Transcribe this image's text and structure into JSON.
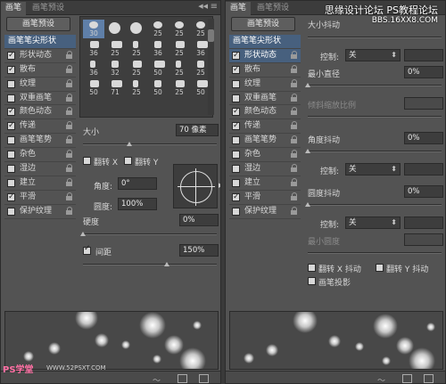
{
  "left_panel": {
    "tabs": [
      "画笔",
      "画笔预设"
    ],
    "presets_button": "画笔预设",
    "sidebar": [
      {
        "label": "画笔笔尖形状",
        "checked": null,
        "header": true
      },
      {
        "label": "形状动态",
        "checked": true
      },
      {
        "label": "散布",
        "checked": true
      },
      {
        "label": "纹理",
        "checked": false
      },
      {
        "label": "双重画笔",
        "checked": false
      },
      {
        "label": "颜色动态",
        "checked": true
      },
      {
        "label": "传递",
        "checked": true
      },
      {
        "label": "画笔笔势",
        "checked": false
      },
      {
        "label": "杂色",
        "checked": false
      },
      {
        "label": "湿边",
        "checked": false
      },
      {
        "label": "建立",
        "checked": false
      },
      {
        "label": "平滑",
        "checked": true
      },
      {
        "label": "保护纹理",
        "checked": false
      }
    ],
    "brush_sizes": [
      "30",
      "",
      "",
      "25",
      "25",
      "25",
      "36",
      "25",
      "25",
      "36",
      "25",
      "36",
      "36",
      "32",
      "25",
      "50",
      "25",
      "25",
      "50",
      "71",
      "25",
      "50",
      "25",
      "50"
    ],
    "size_label": "大小",
    "size_value": "70 像素",
    "flip_x": "翻转 X",
    "flip_y": "翻转 Y",
    "angle_label": "角度:",
    "angle_value": "0°",
    "roundness_label": "圆度:",
    "roundness_value": "100%",
    "hardness_label": "硬度",
    "hardness_value": "0%",
    "spacing_label": "间距",
    "spacing_value": "150%"
  },
  "right_panel": {
    "tabs": [
      "画笔",
      "画笔预设"
    ],
    "presets_button": "画笔预设",
    "sidebar": [
      {
        "label": "画笔笔尖形状",
        "checked": null,
        "header": true
      },
      {
        "label": "形状动态",
        "checked": true,
        "selected": true
      },
      {
        "label": "散布",
        "checked": true
      },
      {
        "label": "纹理",
        "checked": false
      },
      {
        "label": "双重画笔",
        "checked": false
      },
      {
        "label": "颜色动态",
        "checked": true
      },
      {
        "label": "传递",
        "checked": true
      },
      {
        "label": "画笔笔势",
        "checked": false
      },
      {
        "label": "杂色",
        "checked": false
      },
      {
        "label": "湿边",
        "checked": false
      },
      {
        "label": "建立",
        "checked": false
      },
      {
        "label": "平滑",
        "checked": true
      },
      {
        "label": "保护纹理",
        "checked": false
      }
    ],
    "size_jitter_label": "大小抖动",
    "control1_label": "控制:",
    "control1_value": "关",
    "min_diameter_label": "最小直径",
    "min_diameter_value": "0%",
    "tilt_scale_label": "倾斜缩放比例",
    "angle_jitter_label": "角度抖动",
    "angle_jitter_value": "0%",
    "control2_label": "控制:",
    "control2_value": "关",
    "roundness_jitter_label": "圆度抖动",
    "roundness_jitter_value": "0%",
    "control3_label": "控制:",
    "control3_value": "关",
    "min_roundness_label": "最小圆度",
    "flip_x_jitter": "翻转 X 抖动",
    "flip_y_jitter": "翻转 Y 抖动",
    "brush_projection": "画笔投影"
  },
  "watermark": {
    "top": "PS教程论坛",
    "top_brand": "思缘设计论坛",
    "sub": "BBS.16XX8.COM",
    "bottom_left": "PS学堂",
    "bottom_left_url": "WWW.52PSXT.COM"
  }
}
